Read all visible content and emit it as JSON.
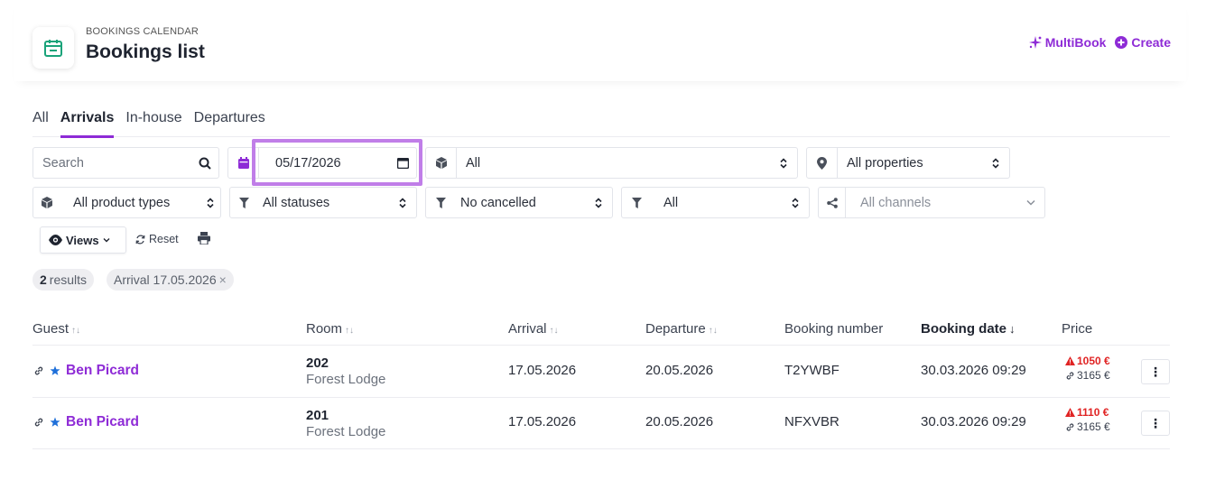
{
  "header": {
    "eyebrow": "BOOKINGS CALENDAR",
    "title": "Bookings list",
    "multibook_label": "MultiBook",
    "create_label": "Create",
    "accent_color": "#8e2bd6"
  },
  "tabs": [
    {
      "label": "All",
      "active": false
    },
    {
      "label": "Arrivals",
      "active": true
    },
    {
      "label": "In-house",
      "active": false
    },
    {
      "label": "Departures",
      "active": false
    }
  ],
  "filters": {
    "search_placeholder": "Search",
    "date_value": "05/17/2026",
    "unit_type_value": "All",
    "property_value": "All properties",
    "product_type_value": "All product types",
    "status_value": "All statuses",
    "cancelled_value": "No cancelled",
    "filter4_value": "All",
    "channels_value": "All channels"
  },
  "toolbar": {
    "views_label": "Views",
    "reset_label": "Reset"
  },
  "chips": {
    "results_count": "2",
    "results_label": "results",
    "arrival_filter": "Arrival 17.05.2026",
    "close_symbol": "×"
  },
  "table": {
    "columns": {
      "guest": "Guest",
      "room": "Room",
      "arrival": "Arrival",
      "departure": "Departure",
      "booking_number": "Booking number",
      "booking_date": "Booking date",
      "price": "Price"
    },
    "rows": [
      {
        "guest": "Ben Picard",
        "room_number": "202",
        "room_name": "Forest Lodge",
        "arrival": "17.05.2026",
        "departure": "20.05.2026",
        "booking_number": "T2YWBF",
        "booking_date": "30.03.2026 09:29",
        "price_alert": "1050 €",
        "price_total": "3165 €"
      },
      {
        "guest": "Ben Picard",
        "room_number": "201",
        "room_name": "Forest Lodge",
        "arrival": "17.05.2026",
        "departure": "20.05.2026",
        "booking_number": "NFXVBR",
        "booking_date": "30.03.2026 09:29",
        "price_alert": "1110 €",
        "price_total": "3165 €"
      }
    ]
  }
}
